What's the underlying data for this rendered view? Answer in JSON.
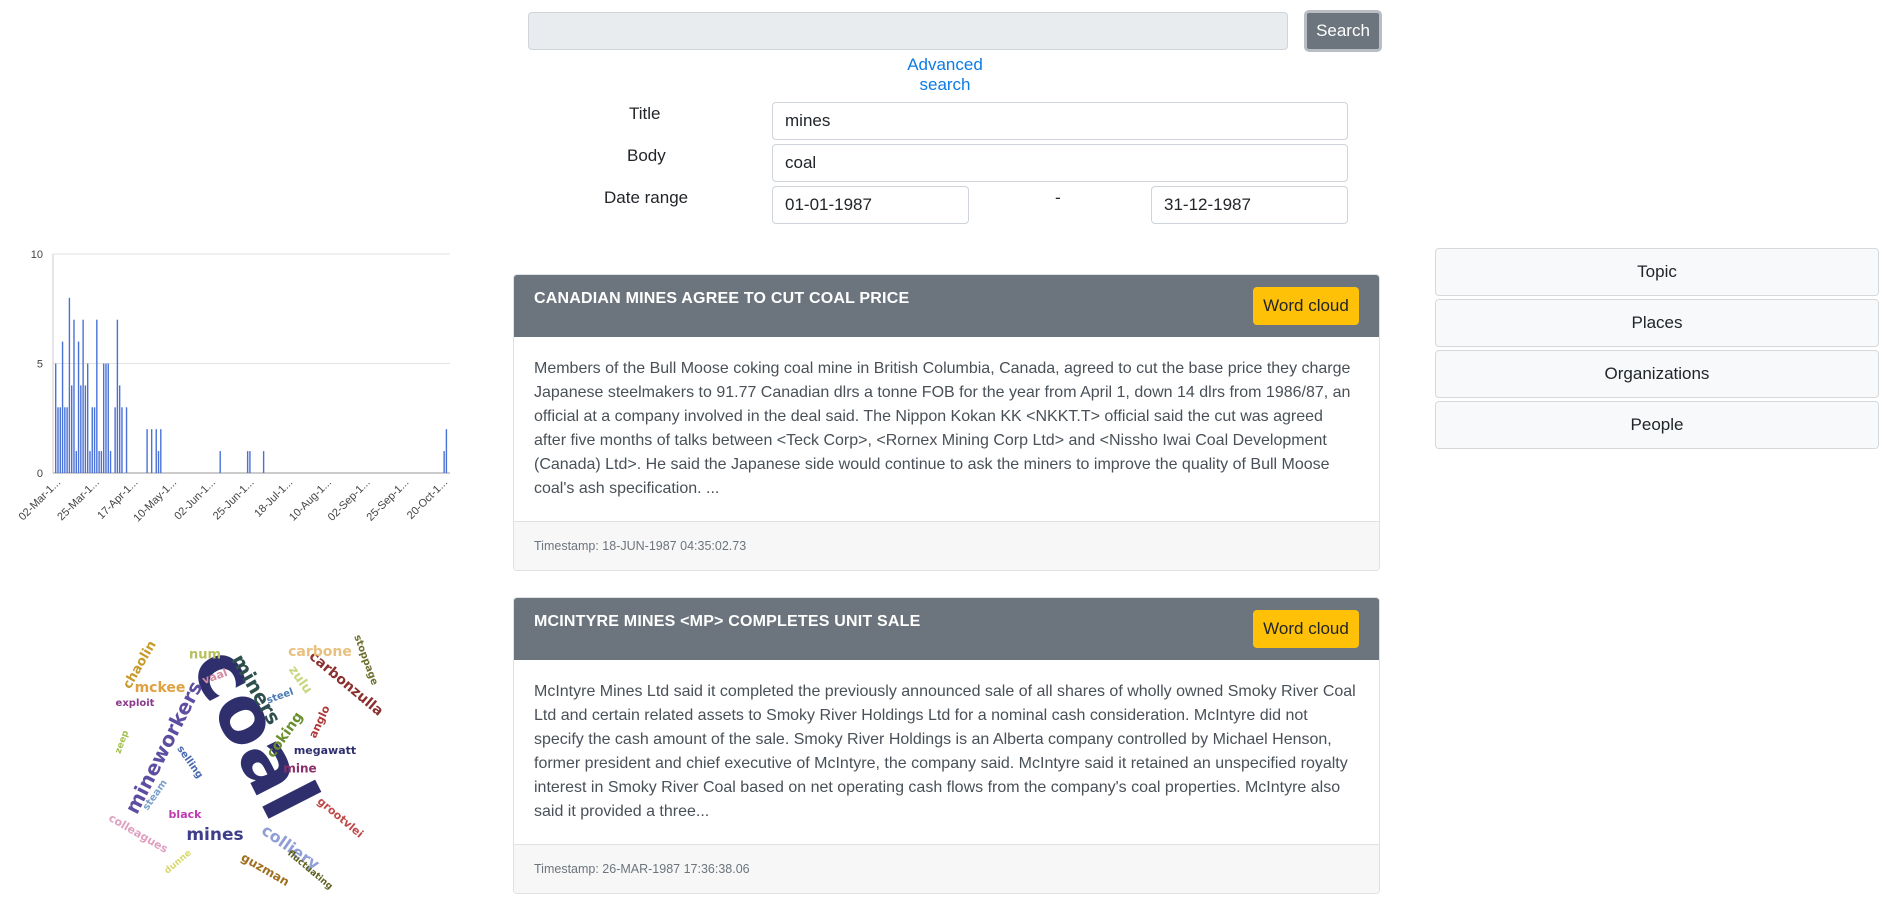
{
  "search": {
    "value": "",
    "button_label": "Search",
    "advanced_link": "Advanced search"
  },
  "form": {
    "title_label": "Title",
    "title_value": "mines",
    "body_label": "Body",
    "body_value": "coal",
    "date_label": "Date range",
    "date_from": "01-01-1987",
    "date_sep": "-",
    "date_to": "31-12-1987"
  },
  "chart_data": {
    "type": "bar",
    "ylim": [
      0,
      10
    ],
    "yticks": [
      "0",
      "5",
      "10"
    ],
    "xtick_labels": [
      "02-Mar-1...",
      "25-Mar-1...",
      "17-Apr-1...",
      "10-May-1...",
      "02-Jun-1...",
      "25-Jun-1...",
      "18-Jul-1...",
      "10-Aug-1...",
      "02-Sep-1...",
      "25-Sep-1...",
      "20-Oct-1..."
    ],
    "grid": true,
    "bar_color": "#4a72d6",
    "points": [
      {
        "x": 0,
        "y": 5
      },
      {
        "x": 1,
        "y": 3
      },
      {
        "x": 2,
        "y": 3
      },
      {
        "x": 3,
        "y": 6
      },
      {
        "x": 4,
        "y": 3
      },
      {
        "x": 5,
        "y": 3
      },
      {
        "x": 6,
        "y": 8
      },
      {
        "x": 7,
        "y": 4
      },
      {
        "x": 8,
        "y": 7
      },
      {
        "x": 9,
        "y": 1
      },
      {
        "x": 10,
        "y": 6
      },
      {
        "x": 11,
        "y": 4
      },
      {
        "x": 12,
        "y": 7
      },
      {
        "x": 13,
        "y": 4
      },
      {
        "x": 14,
        "y": 5
      },
      {
        "x": 15,
        "y": 1
      },
      {
        "x": 16,
        "y": 3
      },
      {
        "x": 17,
        "y": 3
      },
      {
        "x": 18,
        "y": 7
      },
      {
        "x": 19,
        "y": 1
      },
      {
        "x": 20,
        "y": 1
      },
      {
        "x": 21,
        "y": 5
      },
      {
        "x": 22,
        "y": 5
      },
      {
        "x": 23,
        "y": 5
      },
      {
        "x": 24,
        "y": 1
      },
      {
        "x": 26,
        "y": 3
      },
      {
        "x": 27,
        "y": 7
      },
      {
        "x": 28,
        "y": 4
      },
      {
        "x": 29,
        "y": 3
      },
      {
        "x": 31,
        "y": 3
      },
      {
        "x": 40,
        "y": 2
      },
      {
        "x": 42,
        "y": 2
      },
      {
        "x": 44,
        "y": 2
      },
      {
        "x": 45,
        "y": 1
      },
      {
        "x": 46,
        "y": 2
      },
      {
        "x": 72,
        "y": 1
      },
      {
        "x": 84,
        "y": 1
      },
      {
        "x": 85,
        "y": 1
      },
      {
        "x": 91,
        "y": 1
      },
      {
        "x": 170,
        "y": 1
      },
      {
        "x": 171,
        "y": 2
      }
    ],
    "x_max": 172
  },
  "wordcloud": {
    "words": [
      {
        "text": "coal",
        "color": "#2f2f6e",
        "size": 78
      },
      {
        "text": "mineworkers",
        "color": "#5e4ea1",
        "size": 20
      },
      {
        "text": "miners",
        "color": "#2f4f4f",
        "size": 20
      },
      {
        "text": "mines",
        "color": "#3e3e8a",
        "size": 17
      },
      {
        "text": "carbonzulla",
        "color": "#8b2f2f",
        "size": 14
      },
      {
        "text": "coking",
        "color": "#6a8f2f",
        "size": 14
      },
      {
        "text": "colliery",
        "color": "#8f9fd6",
        "size": 16
      },
      {
        "text": "mckee",
        "color": "#e0a040",
        "size": 14
      },
      {
        "text": "carbone",
        "color": "#e8c080",
        "size": 14
      },
      {
        "text": "chaolin",
        "color": "#c89a2a",
        "size": 13
      },
      {
        "text": "num",
        "color": "#b8c060",
        "size": 13
      },
      {
        "text": "zulu",
        "color": "#c8d880",
        "size": 13
      },
      {
        "text": "stoppage",
        "color": "#707030",
        "size": 10
      },
      {
        "text": "vaal",
        "color": "#d48aa0",
        "size": 11
      },
      {
        "text": "exploit",
        "color": "#8b3a8b",
        "size": 10
      },
      {
        "text": "steel",
        "color": "#4a7ab0",
        "size": 10
      },
      {
        "text": "anglo",
        "color": "#b03a3a",
        "size": 11
      },
      {
        "text": "zeep",
        "color": "#a0c050",
        "size": 9
      },
      {
        "text": "selling",
        "color": "#4a6ab0",
        "size": 10
      },
      {
        "text": "megawatt",
        "color": "#2f2f6e",
        "size": 11
      },
      {
        "text": "mine",
        "color": "#8b2f6a",
        "size": 12
      },
      {
        "text": "steam",
        "color": "#7aa0c8",
        "size": 10
      },
      {
        "text": "black",
        "color": "#c03ab0",
        "size": 11
      },
      {
        "text": "grootvlei",
        "color": "#c04a4a",
        "size": 11
      },
      {
        "text": "colleagues",
        "color": "#e0a0c0",
        "size": 11
      },
      {
        "text": "dunne",
        "color": "#d8d870",
        "size": 9
      },
      {
        "text": "fluctuating",
        "color": "#606020",
        "size": 9
      },
      {
        "text": "guzman",
        "color": "#a07020",
        "size": 12
      }
    ]
  },
  "results": [
    {
      "title": "CANADIAN MINES AGREE TO CUT COAL PRICE",
      "wordcloud_label": "Word cloud",
      "body": "Members of the Bull Moose coking coal mine in British Columbia, Canada, agreed to cut the base price they charge Japanese steelmakers to 91.77 Canadian dlrs a tonne FOB for the year from April 1, down 14 dlrs from 1986/87, an official at a company involved in the deal said. The Nippon Kokan KK <NKKT.T> official said the cut was agreed after five months of talks between <Teck Corp>, <Rornex Mining Corp Ltd> and <Nissho Iwai Coal Development (Canada) Ltd>. He said the Japanese side would continue to ask the miners to improve the quality of Bull Moose coal's ash specification. ...",
      "timestamp": "Timestamp: 18-JUN-1987 04:35:02.73"
    },
    {
      "title": "MCINTYRE MINES <MP> COMPLETES UNIT SALE",
      "wordcloud_label": "Word cloud",
      "body": "McIntyre Mines Ltd said it completed the previously announced sale of all shares of wholly owned Smoky River Coal Ltd and certain related assets to Smoky River Holdings Ltd for a nominal cash consideration. McIntyre did not specify the cash amount of the sale. Smoky River Holdings is an Alberta company controlled by Michael Henson, former president and chief executive of McIntyre, the company said. McIntyre said it retained an unspecified royalty interest in Smoky River Coal based on net operating cash flows from the company's coal properties. McIntyre also said it provided a three...",
      "timestamp": "Timestamp: 26-MAR-1987 17:36:38.06"
    }
  ],
  "facets": [
    "Topic",
    "Places",
    "Organizations",
    "People"
  ]
}
